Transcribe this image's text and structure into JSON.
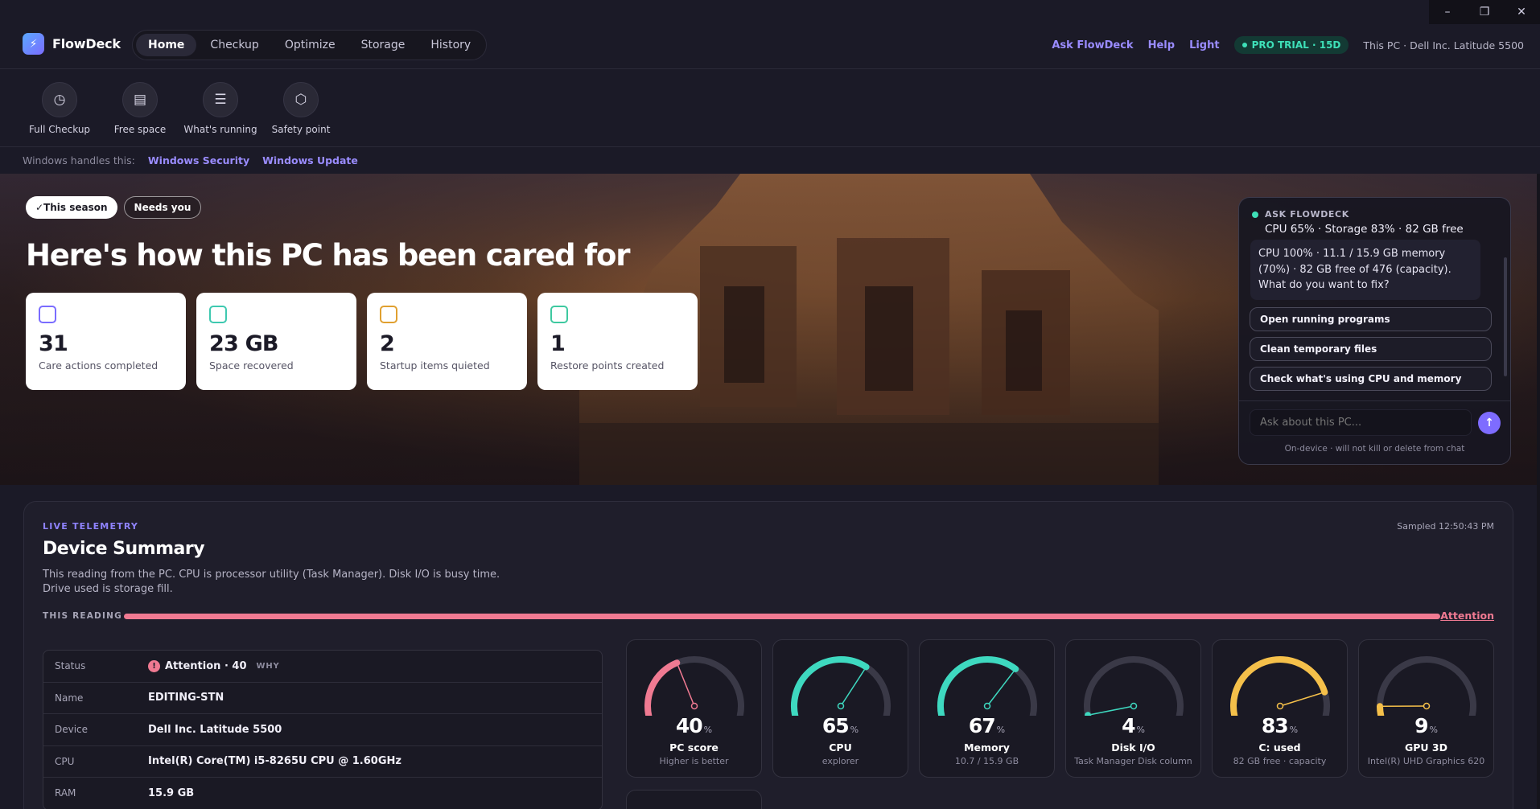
{
  "window": {
    "minimize": "–",
    "restore": "❐",
    "close": "✕"
  },
  "brand": {
    "name": "FlowDeck",
    "logo_icon": "bolt-icon"
  },
  "nav": {
    "items": [
      {
        "label": "Home",
        "active": true
      },
      {
        "label": "Checkup",
        "active": false
      },
      {
        "label": "Optimize",
        "active": false
      },
      {
        "label": "Storage",
        "active": false
      },
      {
        "label": "History",
        "active": false
      }
    ]
  },
  "topright": {
    "ask": "Ask FlowDeck",
    "help": "Help",
    "theme": "Light",
    "pro": "PRO TRIAL · 15D",
    "thispc": "This PC · Dell Inc. Latitude 5500"
  },
  "quick_actions": [
    {
      "label": "Full Checkup",
      "icon": "clock-icon",
      "glyph": "◷"
    },
    {
      "label": "Free space",
      "icon": "disk-icon",
      "glyph": "▤"
    },
    {
      "label": "What's running",
      "icon": "list-icon",
      "glyph": "☰"
    },
    {
      "label": "Safety point",
      "icon": "hexagon-icon",
      "glyph": "⬡"
    }
  ],
  "windows_handles": {
    "label": "Windows handles this:",
    "links": [
      "Windows Security",
      "Windows Update"
    ]
  },
  "hero": {
    "pills": [
      "✓This season",
      "Needs you"
    ],
    "title": "Here's how this PC has been cared for",
    "stats": [
      {
        "value": "31",
        "label": "Care actions completed",
        "color": "#7a6cff"
      },
      {
        "value": "23 GB",
        "label": "Space recovered",
        "color": "#3ec9b0"
      },
      {
        "value": "2",
        "label": "Startup items quieted",
        "color": "#e0a030"
      },
      {
        "value": "1",
        "label": "Restore points created",
        "color": "#3ec9a0"
      }
    ]
  },
  "ask_panel": {
    "eyebrow": "ASK FLOWDECK",
    "subtitle": "CPU 65% · Storage 83% · 82 GB free",
    "message": "CPU 100% · 11.1 / 15.9 GB memory (70%) · 82 GB free of 476 (capacity). What do you want to fix?",
    "suggestions": [
      "Open running programs",
      "Clean temporary files",
      "Check what's using CPU and memory"
    ],
    "placeholder": "Ask about this PC...",
    "send_icon": "↑",
    "footer": "On-device · will not kill or delete from chat"
  },
  "summary": {
    "eyebrow": "LIVE TELEMETRY",
    "sampled": "Sampled 12:50:43 PM",
    "title": "Device Summary",
    "description": "This reading from the PC. CPU is processor utility (Task Manager). Disk I/O is busy time. Drive used is storage fill.",
    "reading_label": "THIS READING",
    "reading_status": "Attention",
    "status_color": "#f07a92",
    "info": [
      {
        "key": "Status",
        "value": "Attention · 40",
        "badge": "!",
        "why": "WHY"
      },
      {
        "key": "Name",
        "value": "EDITING-STN"
      },
      {
        "key": "Device",
        "value": "Dell Inc. Latitude 5500"
      },
      {
        "key": "CPU",
        "value": "Intel(R) Core(TM) i5-8265U CPU @ 1.60GHz"
      },
      {
        "key": "RAM",
        "value": "15.9 GB"
      }
    ],
    "gauges": [
      {
        "value": 40,
        "unit": "%",
        "name": "PC score",
        "sub": "Higher is better",
        "color": "#f07a92"
      },
      {
        "value": 65,
        "unit": "%",
        "name": "CPU",
        "sub": "explorer",
        "color": "#3ed9c0"
      },
      {
        "value": 67,
        "unit": "%",
        "name": "Memory",
        "sub": "10.7 / 15.9 GB",
        "color": "#3ed9c0"
      },
      {
        "value": 4,
        "unit": "%",
        "name": "Disk I/O",
        "sub": "Task Manager Disk column",
        "color": "#3ed9c0"
      },
      {
        "value": 83,
        "unit": "%",
        "name": "C: used",
        "sub": "82 GB free · capacity",
        "color": "#f5c04a"
      },
      {
        "value": 9,
        "unit": "%",
        "name": "GPU 3D",
        "sub": "Intel(R) UHD Graphics 620",
        "color": "#f5c04a"
      }
    ]
  }
}
